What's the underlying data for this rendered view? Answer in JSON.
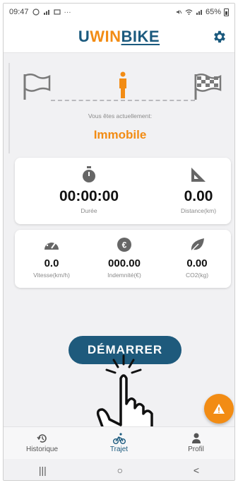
{
  "status_bar": {
    "time": "09:47",
    "left_icons": [
      "whatsapp-icon",
      "signal-icon",
      "gallery-icon",
      "more-icon"
    ],
    "right_icons": [
      "mute-icon",
      "wifi-icon",
      "signal-icon"
    ],
    "battery": "65%"
  },
  "header": {
    "logo_part1": "U",
    "logo_part2": "WIN",
    "logo_part3": "BIKE",
    "settings_icon": "gear-icon",
    "colors": {
      "brand_blue": "#1b5a7e",
      "brand_orange": "#f28c14"
    }
  },
  "trip_status": {
    "start_icon": "start-flag-icon",
    "end_icon": "finish-flag-icon",
    "current_label": "Vous êtes actuellement:",
    "current_value": "Immobile"
  },
  "stats_card1": {
    "duration_icon": "stopwatch-icon",
    "duration_value": "00:00:00",
    "duration_label": "Durée",
    "distance_icon": "ruler-triangle-icon",
    "distance_value": "0.00",
    "distance_label": "Distance(km)"
  },
  "stats_card2": {
    "speed_icon": "speedometer-icon",
    "speed_value": "0.0",
    "speed_label": "Vitesse(km/h)",
    "indemnity_icon": "euro-coin-icon",
    "indemnity_value": "000.00",
    "indemnity_label": "Indemnité(€)",
    "co2_icon": "leaf-icon",
    "co2_value": "0.00",
    "co2_label": "CO2(kg)"
  },
  "actions": {
    "start_label": "DÉMARRER",
    "alert_icon": "warning-icon"
  },
  "bottom_nav": {
    "items": [
      {
        "label": "Historique",
        "icon": "history-icon"
      },
      {
        "label": "Trajet",
        "icon": "bike-icon"
      },
      {
        "label": "Profil",
        "icon": "person-icon"
      }
    ],
    "active": "Trajet"
  },
  "system_nav": {
    "recents": "|||",
    "home": "○",
    "back": "<"
  }
}
